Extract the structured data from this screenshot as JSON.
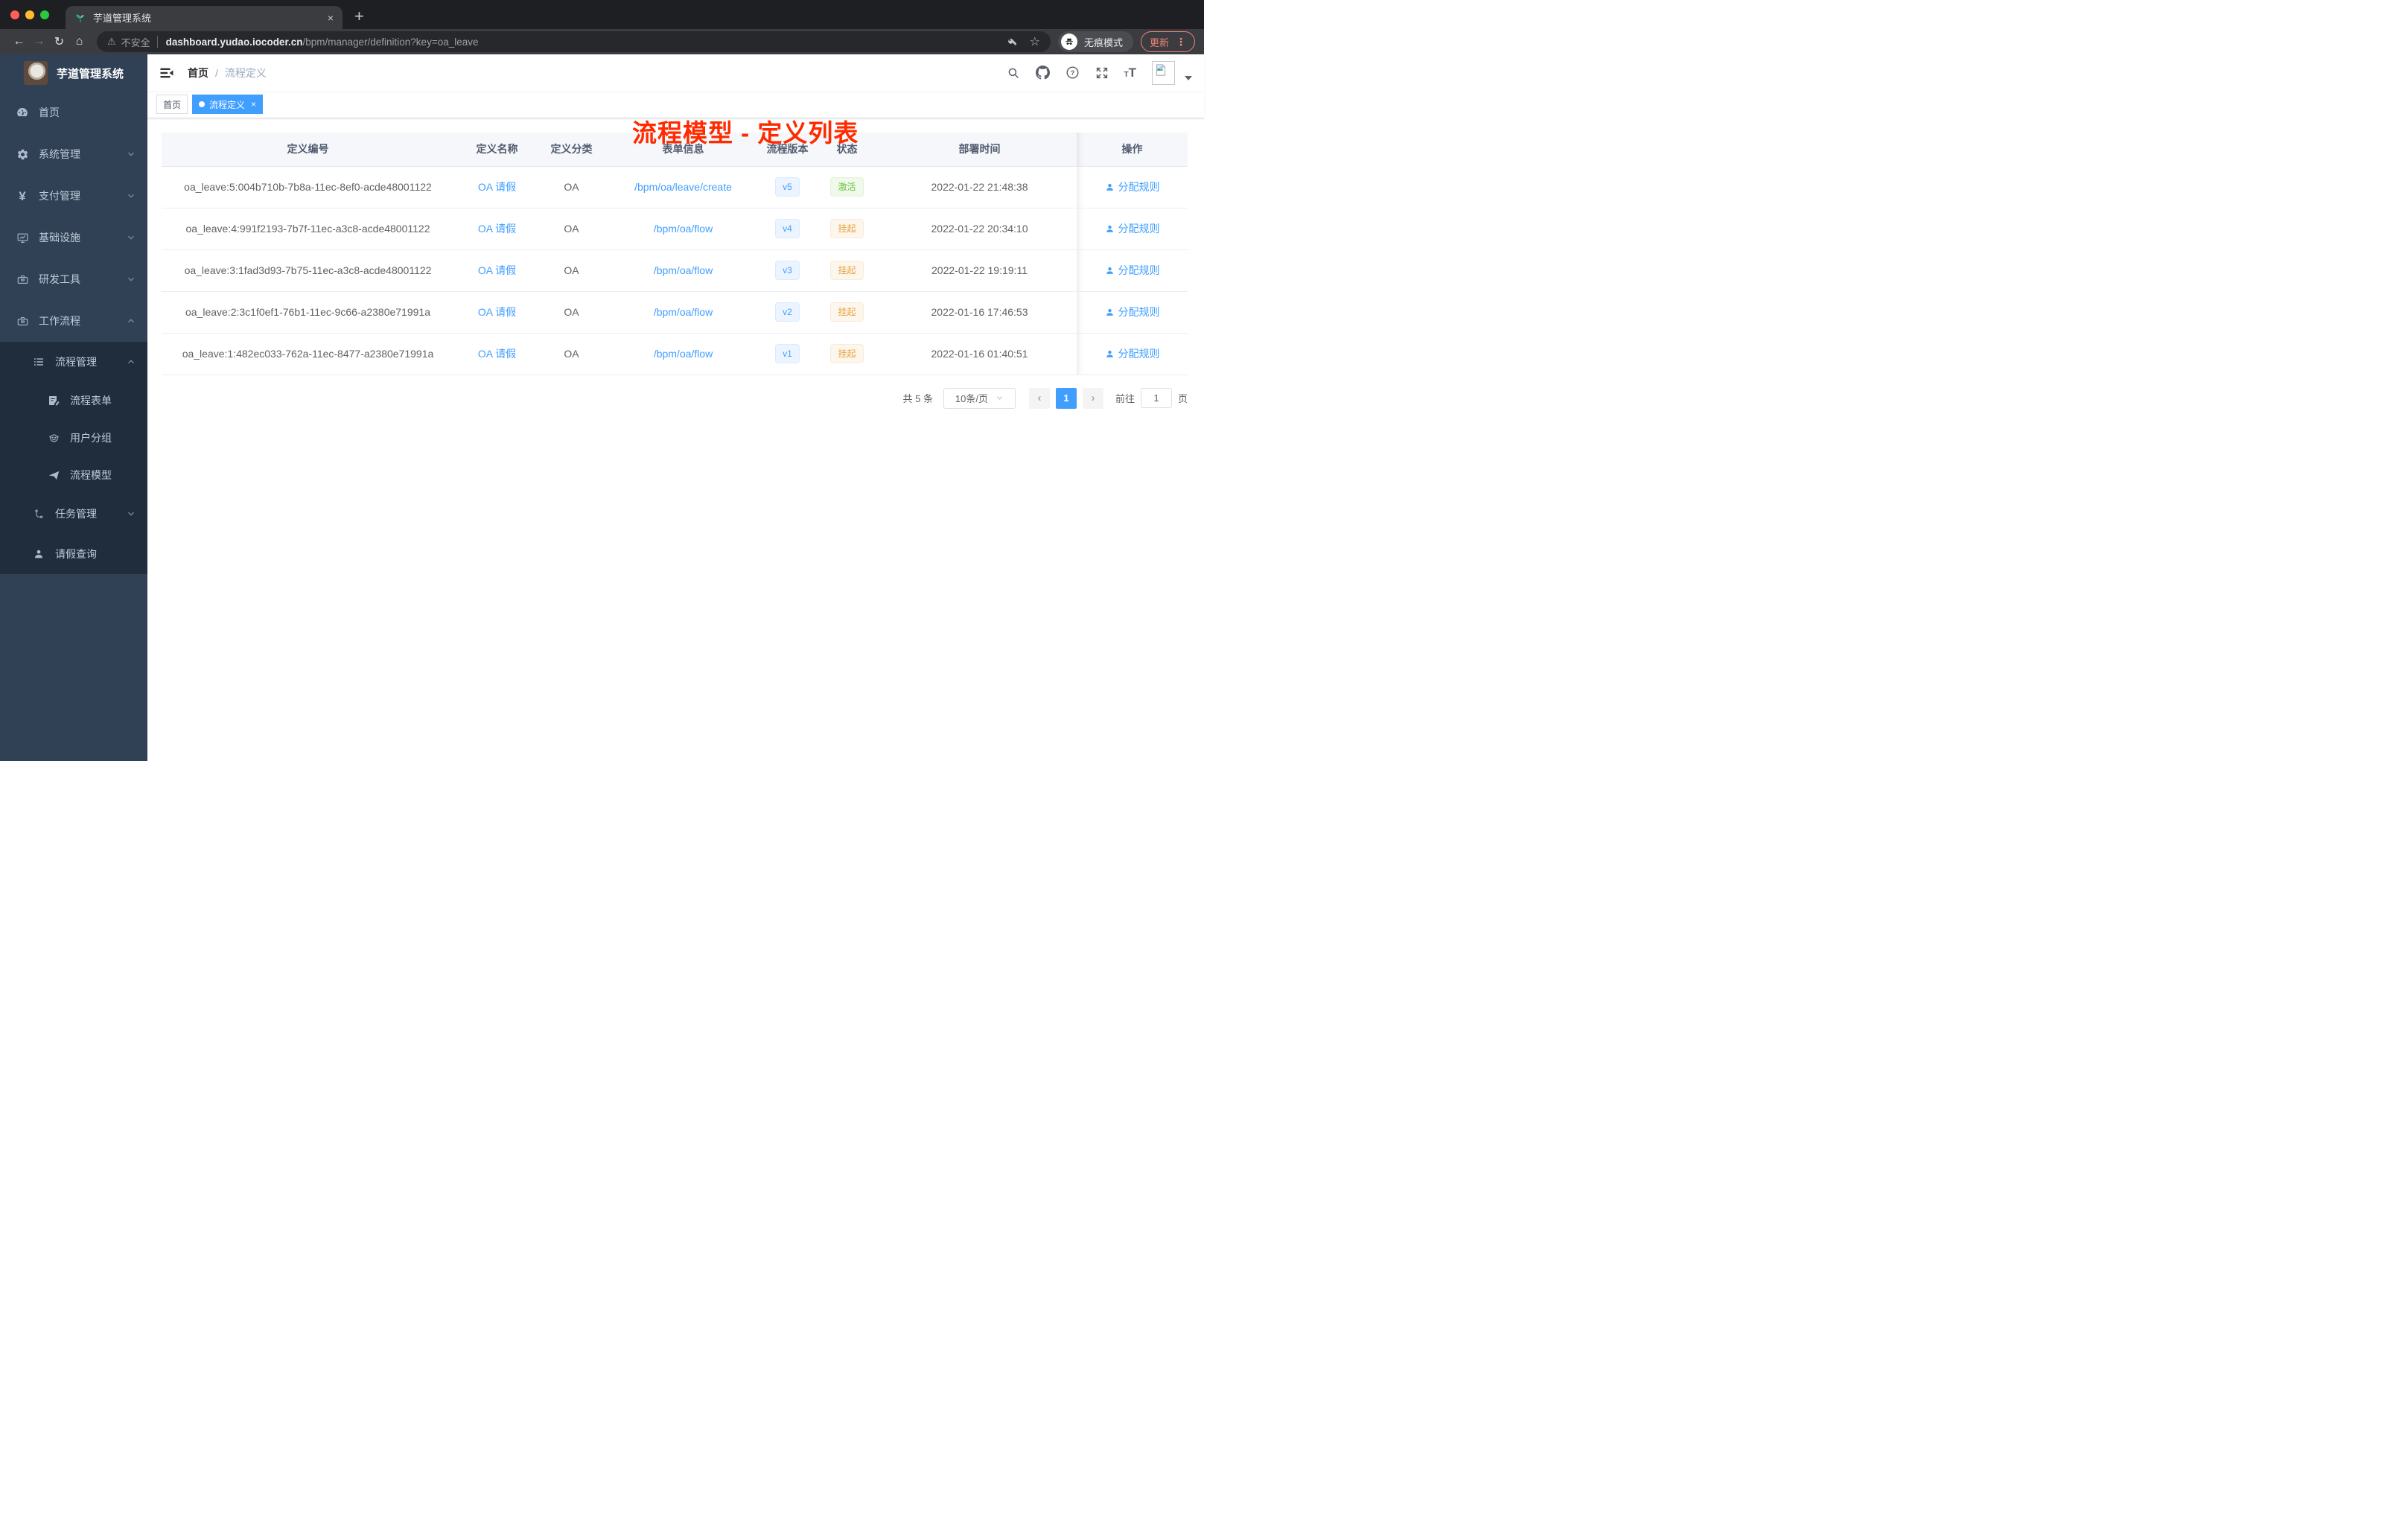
{
  "browser": {
    "tab_title": "芋道管理系统",
    "security_label": "不安全",
    "url_host": "dashboard.yudao.iocoder.cn",
    "url_path": "/bpm/manager/definition?key=oa_leave",
    "incognito_label": "无痕模式",
    "update_label": "更新"
  },
  "icons": {
    "new_tab": "+",
    "tab_close": "×",
    "back": "←",
    "forward": "→",
    "reload": "↻",
    "home": "⌂",
    "warning": "⚠",
    "bookmark_star": "☆",
    "menu_dots": "⋮",
    "help": "?",
    "yen": "¥",
    "tag_close": "×",
    "prev": "‹",
    "next": "›"
  },
  "sidebar": {
    "logo_title": "芋道管理系统",
    "items": [
      {
        "label": "首页",
        "icon": "dashboard-icon"
      },
      {
        "label": "系统管理",
        "icon": "gear-icon"
      },
      {
        "label": "支付管理",
        "icon": "yen-icon"
      },
      {
        "label": "基础设施",
        "icon": "monitor-icon"
      },
      {
        "label": "研发工具",
        "icon": "toolbox-icon"
      },
      {
        "label": "工作流程",
        "icon": "toolbox-icon"
      },
      {
        "label": "流程管理",
        "icon": "list-icon"
      },
      {
        "label": "流程表单",
        "icon": "form-icon"
      },
      {
        "label": "用户分组",
        "icon": "group-icon"
      },
      {
        "label": "流程模型",
        "icon": "send-icon"
      },
      {
        "label": "任务管理",
        "icon": "tree-icon"
      },
      {
        "label": "请假查询",
        "icon": "person-icon"
      }
    ]
  },
  "navbar": {
    "breadcrumb_home": "首页",
    "breadcrumb_separator": "/",
    "breadcrumb_current": "流程定义"
  },
  "tags": {
    "home": "首页",
    "active": "流程定义"
  },
  "annotation": "流程模型 - 定义列表",
  "table": {
    "columns": [
      "定义编号",
      "定义名称",
      "定义分类",
      "表单信息",
      "流程版本",
      "状态",
      "部署时间",
      "操作"
    ],
    "action_label": "分配规则",
    "rows": [
      {
        "id": "oa_leave:5:004b710b-7b8a-11ec-8ef0-acde48001122",
        "name": "OA 请假",
        "category": "OA",
        "form": "/bpm/oa/leave/create",
        "version": "v5",
        "status": "激活",
        "time": "2022-01-22 21:48:38"
      },
      {
        "id": "oa_leave:4:991f2193-7b7f-11ec-a3c8-acde48001122",
        "name": "OA 请假",
        "category": "OA",
        "form": "/bpm/oa/flow",
        "version": "v4",
        "status": "挂起",
        "time": "2022-01-22 20:34:10"
      },
      {
        "id": "oa_leave:3:1fad3d93-7b75-11ec-a3c8-acde48001122",
        "name": "OA 请假",
        "category": "OA",
        "form": "/bpm/oa/flow",
        "version": "v3",
        "status": "挂起",
        "time": "2022-01-22 19:19:11"
      },
      {
        "id": "oa_leave:2:3c1f0ef1-76b1-11ec-9c66-a2380e71991a",
        "name": "OA 请假",
        "category": "OA",
        "form": "/bpm/oa/flow",
        "version": "v2",
        "status": "挂起",
        "time": "2022-01-16 17:46:53"
      },
      {
        "id": "oa_leave:1:482ec033-762a-11ec-8477-a2380e71991a",
        "name": "OA 请假",
        "category": "OA",
        "form": "/bpm/oa/flow",
        "version": "v1",
        "status": "挂起",
        "time": "2022-01-16 01:40:51"
      }
    ]
  },
  "pagination": {
    "total": "共 5 条",
    "page_size": "10条/页",
    "current_page": "1",
    "goto_label": "前往",
    "goto_value": "1",
    "page_unit": "页"
  },
  "colors": {
    "accent_blue": "#409eff",
    "annotation_red": "#ff2a00",
    "status_active_green": "#67c23a",
    "status_suspend_orange": "#e6a23c",
    "version_badge_blue": "#409eff",
    "sidebar_bg": "#304156",
    "sidebar_submenu_bg": "#1f2d3d",
    "table_header_bg": "#f5f7fa"
  }
}
